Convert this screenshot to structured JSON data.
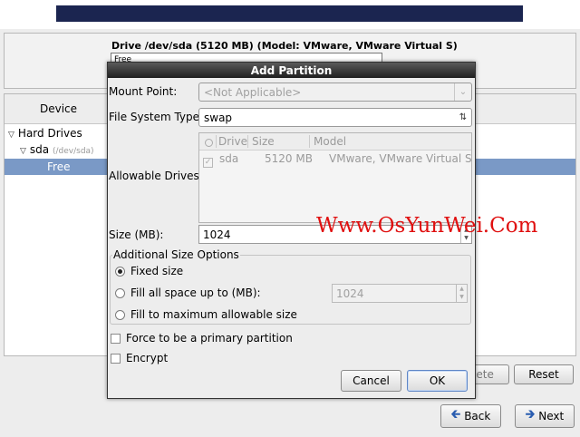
{
  "background": {
    "drive_title": "Drive /dev/sda (5120 MB) (Model: VMware, VMware Virtual S)",
    "drive_bar_label": "Free",
    "tree_header": "Device",
    "tree": {
      "hard_drives": "Hard Drives",
      "sda": "sda",
      "sda_path": "(/dev/sda)",
      "free": "Free"
    },
    "buttons": {
      "delete_partial": "lete",
      "reset": "Reset",
      "back": "Back",
      "next": "Next"
    }
  },
  "dialog": {
    "title": "Add Partition",
    "mount_point": {
      "label": "Mount Point:",
      "value": "<Not Applicable>"
    },
    "fs_type": {
      "label": "File System Type:",
      "value": "swap"
    },
    "allowable_drives": {
      "label": "Allowable Drives:",
      "columns": [
        "Drive",
        "Size",
        "Model"
      ],
      "rows": [
        {
          "checked": true,
          "drive": "sda",
          "size": "5120 MB",
          "model": "VMware, VMware Virtual S"
        }
      ]
    },
    "size": {
      "label": "Size (MB):",
      "value": "1024"
    },
    "additional": {
      "legend": "Additional Size Options",
      "fixed": "Fixed size",
      "fill_upto": "Fill all space up to (MB):",
      "fill_upto_value": "1024",
      "fill_max": "Fill to maximum allowable size",
      "selected": "fixed"
    },
    "primary_label": "Force to be a primary partition",
    "encrypt_label": "Encrypt",
    "cancel": "Cancel",
    "ok": "OK"
  },
  "watermark": "Www.OsYunWei.Com",
  "icons": {
    "back_arrow": "arrow-left-icon",
    "next_arrow": "arrow-right-icon",
    "combo_arrow": "chevron-down-icon",
    "combo_updown": "updown-icon"
  },
  "colors": {
    "selection": "#7a99c6",
    "title_bar": "#1f1f1f",
    "banner": "#1b2550",
    "watermark": "#e01010"
  }
}
